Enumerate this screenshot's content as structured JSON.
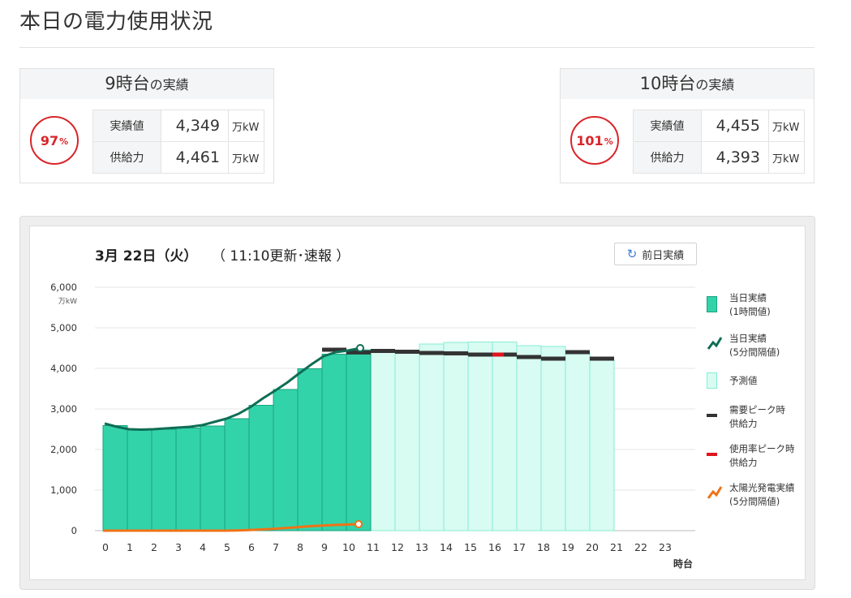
{
  "page": {
    "title": "本日の電力使用状況"
  },
  "cards": [
    {
      "title_main": "9時台",
      "title_suffix": "の実績",
      "rate": "97",
      "rate_unit": "%",
      "rows": [
        {
          "label": "実績値",
          "value": "4,349",
          "unit": "万kW"
        },
        {
          "label": "供給力",
          "value": "4,461",
          "unit": "万kW"
        }
      ]
    },
    {
      "title_main": "10時台",
      "title_suffix": "の実績",
      "rate": "101",
      "rate_unit": "%",
      "rows": [
        {
          "label": "実績値",
          "value": "4,455",
          "unit": "万kW"
        },
        {
          "label": "供給力",
          "value": "4,393",
          "unit": "万kW"
        }
      ]
    }
  ],
  "chart_header": {
    "date": "3月 22日（火）",
    "update": "（ 11:10更新･速報 ）",
    "prev_button": "前日実績"
  },
  "legend": [
    {
      "key": "actual",
      "line1": "当日実績",
      "line2": "(1時間値)"
    },
    {
      "key": "actual5",
      "line1": "当日実績",
      "line2": "(5分間隔値)"
    },
    {
      "key": "forecast",
      "line1": "予測値",
      "line2": ""
    },
    {
      "key": "peak_supply",
      "line1": "需要ピーク時",
      "line2": "供給力"
    },
    {
      "key": "rate_peak_supply",
      "line1": "使用率ピーク時",
      "line2": "供給力"
    },
    {
      "key": "solar",
      "line1": "太陽光発電実績",
      "line2": "(5分間隔値)"
    }
  ],
  "colors": {
    "actual_fill": "#33d3aa",
    "actual_stroke": "#1aa37f",
    "forecast_fill": "#d8fbf2",
    "forecast_stroke": "#85eed1",
    "line5": "#0f6e55",
    "supply": "#333333",
    "rate_peak": "#e0151d",
    "solar": "#f07316",
    "grid": "#e6e6e6"
  },
  "chart_data": {
    "type": "bar",
    "ylabel": "万kW",
    "xlabel": "時台",
    "ylim": [
      0,
      6000
    ],
    "yticks": [
      0,
      1000,
      2000,
      3000,
      4000,
      5000,
      6000
    ],
    "ytick_labels": [
      "0",
      "1,000",
      "2,000",
      "3,000",
      "4,000",
      "5,000",
      "6,000"
    ],
    "categories": [
      "0",
      "1",
      "2",
      "3",
      "4",
      "5",
      "6",
      "7",
      "8",
      "9",
      "10",
      "11",
      "12",
      "13",
      "14",
      "15",
      "16",
      "17",
      "18",
      "19",
      "20",
      "21",
      "22",
      "23"
    ],
    "series": [
      {
        "key": "actual",
        "name": "当日実績",
        "values": [
          2590,
          2490,
          2500,
          2530,
          2580,
          2760,
          3090,
          3480,
          3990,
          4349,
          4455,
          null,
          null,
          null,
          null,
          null,
          null,
          null,
          null,
          null,
          null,
          null,
          null,
          null
        ]
      },
      {
        "key": "forecast",
        "name": "予測値",
        "values": [
          null,
          null,
          null,
          null,
          null,
          null,
          null,
          null,
          null,
          null,
          null,
          4430,
          4400,
          4600,
          4640,
          4650,
          4650,
          4560,
          4540,
          4390,
          4200,
          null,
          null,
          null
        ]
      },
      {
        "key": "peak_supply",
        "name": "需要ピーク時",
        "values": [
          null,
          null,
          null,
          null,
          null,
          null,
          null,
          null,
          null,
          4461,
          4393,
          4430,
          4410,
          4380,
          4370,
          4340,
          4340,
          4280,
          4240,
          4400,
          4240,
          null,
          null,
          null
        ]
      },
      {
        "key": "rate_peak_supply",
        "name": "使用率ピーク時",
        "index": 16,
        "value": 4340
      },
      {
        "key": "actual5",
        "name": "当日実績",
        "x": [
          0,
          0.5,
          1,
          1.5,
          2,
          2.5,
          3,
          3.5,
          4,
          4.5,
          5,
          5.5,
          6,
          6.5,
          7,
          7.5,
          8,
          8.5,
          9,
          9.5,
          10,
          10.5
        ],
        "y": [
          2640,
          2560,
          2500,
          2490,
          2500,
          2520,
          2540,
          2560,
          2600,
          2680,
          2760,
          2880,
          3050,
          3260,
          3450,
          3650,
          3880,
          4100,
          4300,
          4400,
          4440,
          4500
        ]
      },
      {
        "key": "solar",
        "name": "太陽光発電実績",
        "x": [
          0,
          1,
          2,
          3,
          4,
          5,
          5.5,
          6,
          6.5,
          7,
          7.5,
          8,
          8.5,
          9,
          9.5,
          10,
          10.5
        ],
        "y": [
          0,
          0,
          0,
          0,
          0,
          0,
          5,
          15,
          30,
          45,
          65,
          85,
          110,
          125,
          140,
          150,
          160
        ]
      }
    ]
  }
}
